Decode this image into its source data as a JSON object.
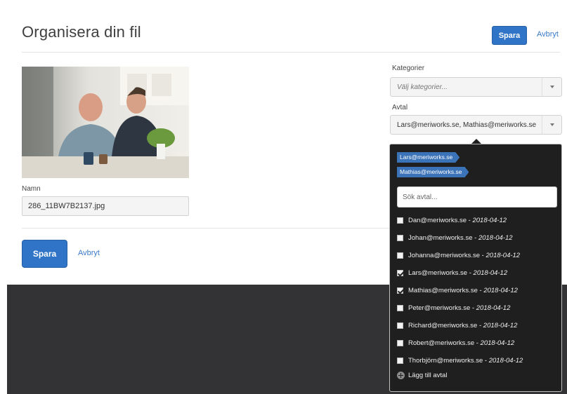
{
  "header": {
    "title": "Organisera din fil",
    "save_label": "Spara",
    "cancel_label": "Avbryt"
  },
  "file": {
    "name_label": "Namn",
    "name_value": "286_11BW7B2137.jpg",
    "photo_description_icon": "photo-two-men-smiling"
  },
  "form_actions": {
    "save_label": "Spara",
    "cancel_label": "Avbryt"
  },
  "categories": {
    "label": "Kategorier",
    "placeholder": "Välj kategorier..."
  },
  "agreements": {
    "label": "Avtal",
    "value": "Lars@meriworks.se, Mathias@meriworks.se",
    "selected_tags": [
      "Lars@meriworks.se",
      "Mathias@meriworks.se"
    ],
    "search_placeholder": "Sök avtal...",
    "options": [
      {
        "email": "Dan@meriworks.se",
        "sep": " - ",
        "date": "2018-04-12",
        "checked": false
      },
      {
        "email": "Johan@meriworks.se",
        "sep": " - ",
        "date": "2018-04-12",
        "checked": false
      },
      {
        "email": "Johanna@meriworks.se",
        "sep": " - ",
        "date": "2018-04-12",
        "checked": false
      },
      {
        "email": "Lars@meriworks.se",
        "sep": " - ",
        "date": "2018-04-12",
        "checked": true
      },
      {
        "email": "Mathias@meriworks.se",
        "sep": " - ",
        "date": "2018-04-12",
        "checked": true
      },
      {
        "email": "Peter@meriworks.se",
        "sep": " - ",
        "date": "2018-04-12",
        "checked": false
      },
      {
        "email": "Richard@meriworks.se",
        "sep": " - ",
        "date": "2018-04-12",
        "checked": false
      },
      {
        "email": "Robert@meriworks.se",
        "sep": " - ",
        "date": "2018-04-12",
        "checked": false
      },
      {
        "email": "Thorbjörn@meriworks.se",
        "sep": " - ",
        "date": "2018-04-12",
        "checked": false
      }
    ],
    "add_label": "Lägg till avtal"
  },
  "colors": {
    "primary": "#2f74c6",
    "link": "#3a7bc8",
    "tag": "#3b73b8",
    "dropdown_bg": "#1f1f1f",
    "footer_bg": "#333335"
  }
}
